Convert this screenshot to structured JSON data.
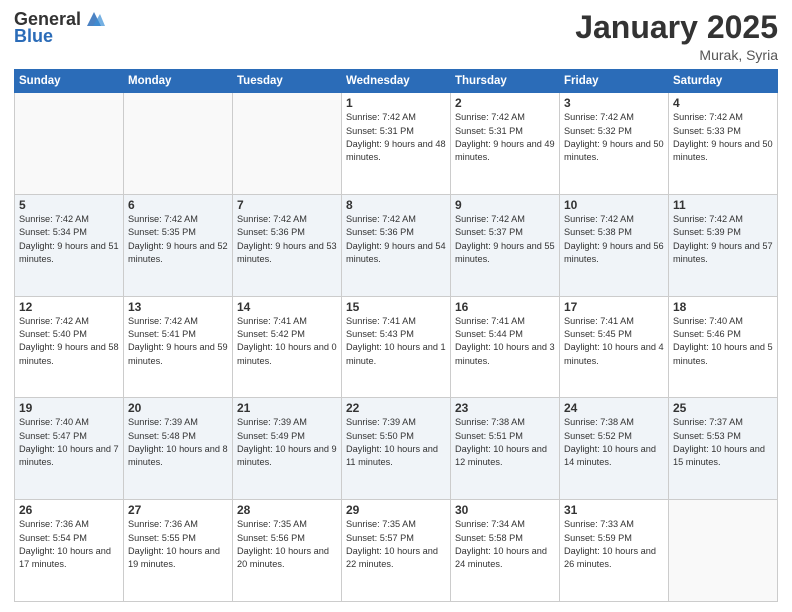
{
  "header": {
    "logo_general": "General",
    "logo_blue": "Blue",
    "month": "January 2025",
    "location": "Murak, Syria"
  },
  "weekdays": [
    "Sunday",
    "Monday",
    "Tuesday",
    "Wednesday",
    "Thursday",
    "Friday",
    "Saturday"
  ],
  "weeks": [
    [
      {
        "day": "",
        "info": ""
      },
      {
        "day": "",
        "info": ""
      },
      {
        "day": "",
        "info": ""
      },
      {
        "day": "1",
        "info": "Sunrise: 7:42 AM\nSunset: 5:31 PM\nDaylight: 9 hours\nand 48 minutes."
      },
      {
        "day": "2",
        "info": "Sunrise: 7:42 AM\nSunset: 5:31 PM\nDaylight: 9 hours\nand 49 minutes."
      },
      {
        "day": "3",
        "info": "Sunrise: 7:42 AM\nSunset: 5:32 PM\nDaylight: 9 hours\nand 50 minutes."
      },
      {
        "day": "4",
        "info": "Sunrise: 7:42 AM\nSunset: 5:33 PM\nDaylight: 9 hours\nand 50 minutes."
      }
    ],
    [
      {
        "day": "5",
        "info": "Sunrise: 7:42 AM\nSunset: 5:34 PM\nDaylight: 9 hours\nand 51 minutes."
      },
      {
        "day": "6",
        "info": "Sunrise: 7:42 AM\nSunset: 5:35 PM\nDaylight: 9 hours\nand 52 minutes."
      },
      {
        "day": "7",
        "info": "Sunrise: 7:42 AM\nSunset: 5:36 PM\nDaylight: 9 hours\nand 53 minutes."
      },
      {
        "day": "8",
        "info": "Sunrise: 7:42 AM\nSunset: 5:36 PM\nDaylight: 9 hours\nand 54 minutes."
      },
      {
        "day": "9",
        "info": "Sunrise: 7:42 AM\nSunset: 5:37 PM\nDaylight: 9 hours\nand 55 minutes."
      },
      {
        "day": "10",
        "info": "Sunrise: 7:42 AM\nSunset: 5:38 PM\nDaylight: 9 hours\nand 56 minutes."
      },
      {
        "day": "11",
        "info": "Sunrise: 7:42 AM\nSunset: 5:39 PM\nDaylight: 9 hours\nand 57 minutes."
      }
    ],
    [
      {
        "day": "12",
        "info": "Sunrise: 7:42 AM\nSunset: 5:40 PM\nDaylight: 9 hours\nand 58 minutes."
      },
      {
        "day": "13",
        "info": "Sunrise: 7:42 AM\nSunset: 5:41 PM\nDaylight: 9 hours\nand 59 minutes."
      },
      {
        "day": "14",
        "info": "Sunrise: 7:41 AM\nSunset: 5:42 PM\nDaylight: 10 hours\nand 0 minutes."
      },
      {
        "day": "15",
        "info": "Sunrise: 7:41 AM\nSunset: 5:43 PM\nDaylight: 10 hours\nand 1 minute."
      },
      {
        "day": "16",
        "info": "Sunrise: 7:41 AM\nSunset: 5:44 PM\nDaylight: 10 hours\nand 3 minutes."
      },
      {
        "day": "17",
        "info": "Sunrise: 7:41 AM\nSunset: 5:45 PM\nDaylight: 10 hours\nand 4 minutes."
      },
      {
        "day": "18",
        "info": "Sunrise: 7:40 AM\nSunset: 5:46 PM\nDaylight: 10 hours\nand 5 minutes."
      }
    ],
    [
      {
        "day": "19",
        "info": "Sunrise: 7:40 AM\nSunset: 5:47 PM\nDaylight: 10 hours\nand 7 minutes."
      },
      {
        "day": "20",
        "info": "Sunrise: 7:39 AM\nSunset: 5:48 PM\nDaylight: 10 hours\nand 8 minutes."
      },
      {
        "day": "21",
        "info": "Sunrise: 7:39 AM\nSunset: 5:49 PM\nDaylight: 10 hours\nand 9 minutes."
      },
      {
        "day": "22",
        "info": "Sunrise: 7:39 AM\nSunset: 5:50 PM\nDaylight: 10 hours\nand 11 minutes."
      },
      {
        "day": "23",
        "info": "Sunrise: 7:38 AM\nSunset: 5:51 PM\nDaylight: 10 hours\nand 12 minutes."
      },
      {
        "day": "24",
        "info": "Sunrise: 7:38 AM\nSunset: 5:52 PM\nDaylight: 10 hours\nand 14 minutes."
      },
      {
        "day": "25",
        "info": "Sunrise: 7:37 AM\nSunset: 5:53 PM\nDaylight: 10 hours\nand 15 minutes."
      }
    ],
    [
      {
        "day": "26",
        "info": "Sunrise: 7:36 AM\nSunset: 5:54 PM\nDaylight: 10 hours\nand 17 minutes."
      },
      {
        "day": "27",
        "info": "Sunrise: 7:36 AM\nSunset: 5:55 PM\nDaylight: 10 hours\nand 19 minutes."
      },
      {
        "day": "28",
        "info": "Sunrise: 7:35 AM\nSunset: 5:56 PM\nDaylight: 10 hours\nand 20 minutes."
      },
      {
        "day": "29",
        "info": "Sunrise: 7:35 AM\nSunset: 5:57 PM\nDaylight: 10 hours\nand 22 minutes."
      },
      {
        "day": "30",
        "info": "Sunrise: 7:34 AM\nSunset: 5:58 PM\nDaylight: 10 hours\nand 24 minutes."
      },
      {
        "day": "31",
        "info": "Sunrise: 7:33 AM\nSunset: 5:59 PM\nDaylight: 10 hours\nand 26 minutes."
      },
      {
        "day": "",
        "info": ""
      }
    ]
  ]
}
